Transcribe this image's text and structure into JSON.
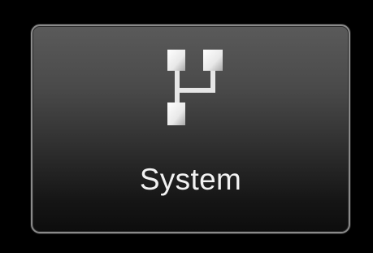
{
  "tile": {
    "label": "System",
    "icon": "system-hierarchy-icon"
  },
  "colors": {
    "background": "#000000",
    "tile_border": "#8a8a8a",
    "text": "#f2f2f2",
    "icon_fill": "#f5f5f5"
  }
}
